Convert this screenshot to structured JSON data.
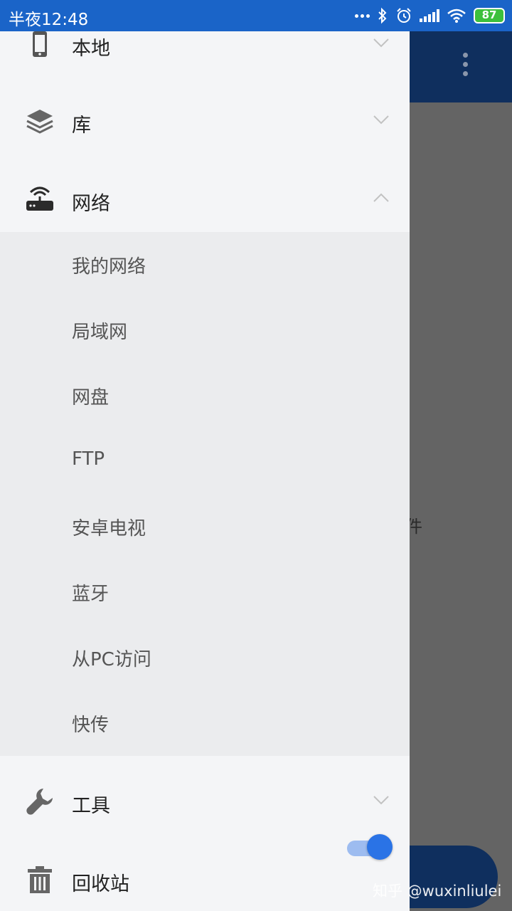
{
  "status_bar": {
    "time": "半夜12:48",
    "battery": "87"
  },
  "drawer": {
    "items": [
      {
        "label": "本地",
        "icon": "phone-icon"
      },
      {
        "label": "库",
        "icon": "layers-icon"
      },
      {
        "label": "网络",
        "icon": "router-icon",
        "expanded": true
      },
      {
        "label": "工具",
        "icon": "wrench-icon"
      },
      {
        "label": "回收站",
        "icon": "trash-icon",
        "toggle_on": true
      }
    ],
    "network_sub": [
      {
        "label": "我的网络"
      },
      {
        "label": "局域网"
      },
      {
        "label": "网盘"
      },
      {
        "label": "FTP"
      },
      {
        "label": "安卓电视"
      },
      {
        "label": "蓝牙"
      },
      {
        "label": "从PC访问"
      },
      {
        "label": "快传"
      }
    ]
  },
  "background": {
    "partial_text": "件"
  },
  "watermark": "知乎 @wuxinliulei",
  "colors": {
    "status_bar": "#1a64c8",
    "toolbar": "#0f2f5e",
    "drawer": "#f4f5f7",
    "sub_panel": "#ebecee",
    "scrim": "#646464",
    "toggle_accent": "#2a73e6"
  }
}
